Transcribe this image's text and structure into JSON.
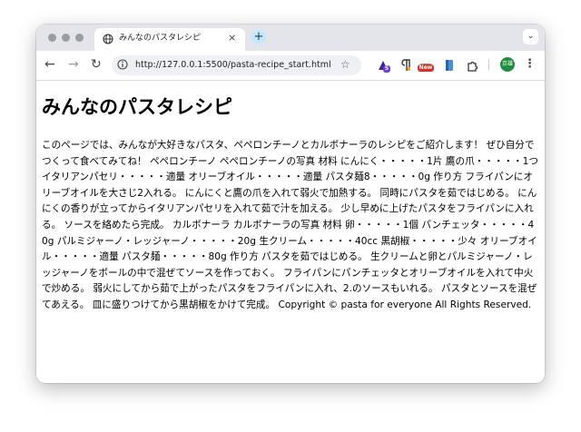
{
  "browser": {
    "tab_title": "みんなのパスタレシピ",
    "tab_close": "×",
    "new_tab": "+",
    "tab_menu": "⌄",
    "back": "←",
    "forward": "→",
    "reload": "↻",
    "url": "http://127.0.0.1:5500/pasta-recipe_start.html",
    "star": "☆",
    "extension_badge_count": "5",
    "extension_badge_new": "New",
    "profile_initials": "京雄",
    "menu": "⋮"
  },
  "page": {
    "heading": "みんなのパスタレシピ",
    "body": "このページでは、みんなが大好きなパスタ、ペペロンチーノとカルボナーラのレシピをご紹介します！ ぜひ自分でつくって食べてみてね！ ペペロンチーノ ペペロンチーノの写真 材料 にんにく・・・・・1片 鷹の爪・・・・・1つ イタリアンパセリ・・・・・適量 オリーブオイル・・・・・適量 パスタ麺8・・・・・0g 作り方 フライパンにオリーブオイルを大さじ2入れる。 にんにくと鷹の爪を入れて弱火で加熱する。 同時にパスタを茹ではじめる。 にんにくの香りが立ってからイタリアンパセリを入れて茹で汁を加える。 少し早めに上げたパスタをフライパンに入れる。 ソースを絡めたら完成。 カルボナーラ カルボナーラの写真 材料 卵・・・・・1個 パンチェッタ・・・・・40g パルミジャーノ・レッジャーノ・・・・・20g 生クリーム・・・・・40cc 黒胡椒・・・・・少々 オリーブオイル・・・・・適量 パスタ麺・・・・・80g 作り方 パスタを茹ではじめる。 生クリームと卵とパルミジャーノ・レッジャーノをボールの中で混ぜてソースを作っておく。 フライパンにパンチェッタとオリーブオイルを入れて中火で炒める。 弱火にしてから茹で上がったパスタをフライパンに入れ、2.のソースもいれる。 パスタとソースを混ぜてあえる。 皿に盛りつけてから黒胡椒をかけて完成。 Copyright © pasta for everyone All Rights Reserved."
  },
  "colors": {
    "tabstrip": "#e3e5ea",
    "omnibox": "#eef0f3",
    "new_tab_button": "#c6e8ff",
    "avatar": "#1e8e3e"
  }
}
